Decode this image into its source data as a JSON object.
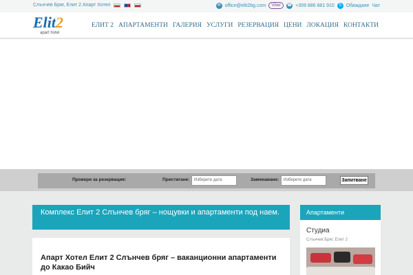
{
  "topbar": {
    "location_text": "Слънчев Бряг, Елит 2 Апарт Хотел",
    "languages": [
      "bg-flag-icon",
      "en-flag-icon",
      "ru-flag-icon"
    ],
    "email": "office@elit2bg.com",
    "viber_label": "Viber",
    "phone": "+359 886 881 910",
    "call_label": "Обаждане",
    "chat_label": "Чат"
  },
  "logo": {
    "main_prefix": "Elit",
    "main_number": "2",
    "subtitle": "apart hotel"
  },
  "nav": {
    "items": [
      "ЕЛИТ 2",
      "АПАРТАМЕНТИ",
      "ГАЛЕРИЯ",
      "УСЛУГИ",
      "РЕЗЕРВАЦИЯ",
      "ЦЕНИ",
      "ЛОКАЦИЯ",
      "КОНТАКТИ"
    ]
  },
  "booking": {
    "check_label": "Провери за резервация:",
    "arrival_label": "Пристигане:",
    "arrival_placeholder": "Изберете дата",
    "departure_label": "Заминаване:",
    "departure_placeholder": "Изберете дата",
    "submit_label": "Запитване"
  },
  "main": {
    "title": "Комплекс Елит 2 Слънчев бряг – нощувки и апартаменти под наем.",
    "article_heading": "Апарт Хотел Елит 2 Слънчев бряг – ваканционни апартаменти до Какао Бийч"
  },
  "sidebar": {
    "header": "Апартаменти",
    "item_title": "Студиа",
    "item_subtitle": "Слънчев Бряг, Елит 2"
  },
  "colors": {
    "accent": "#1aa5bb",
    "link": "#3a8fb7",
    "viber": "#7b519d",
    "skype": "#00aff0"
  }
}
